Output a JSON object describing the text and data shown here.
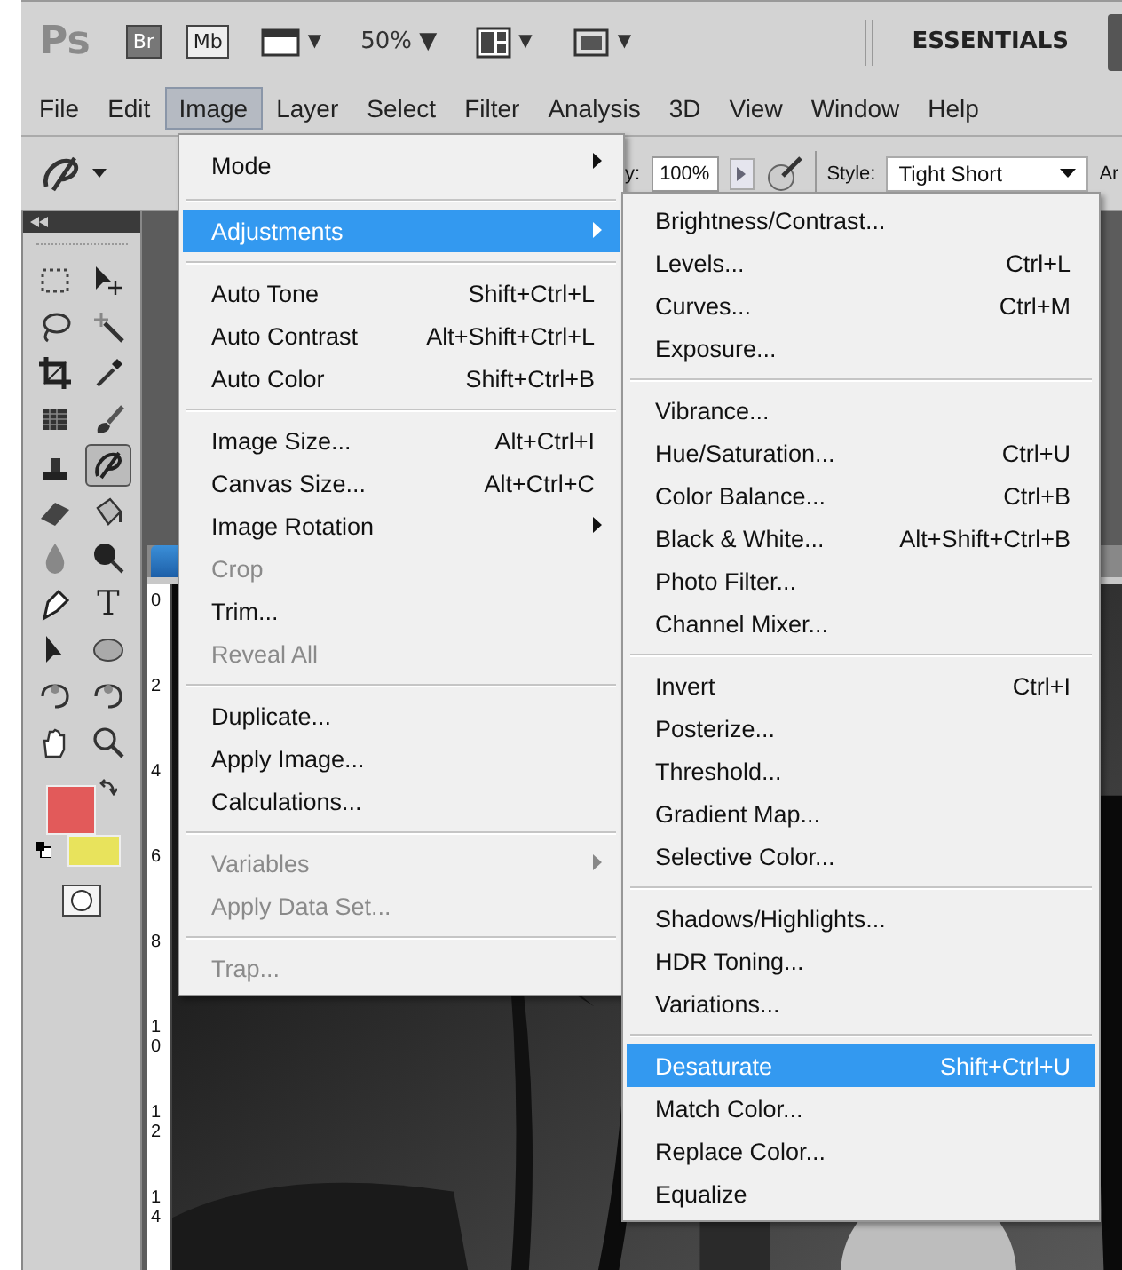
{
  "app_bar": {
    "logo": "Ps",
    "buttons": [
      {
        "kind": "text",
        "label": "Br"
      },
      {
        "kind": "text",
        "label": "Mb"
      },
      {
        "kind": "film",
        "label": "▼"
      },
      {
        "kind": "zoom",
        "label": "50%",
        "caret": "▼"
      },
      {
        "kind": "layout",
        "label": "▼"
      },
      {
        "kind": "screen",
        "label": "▼"
      }
    ],
    "workspace": "ESSENTIALS"
  },
  "menu_bar": [
    {
      "label": "File",
      "selected": false
    },
    {
      "label": "Edit",
      "selected": false
    },
    {
      "label": "Image",
      "selected": true
    },
    {
      "label": "Layer",
      "selected": false
    },
    {
      "label": "Select",
      "selected": false
    },
    {
      "label": "Filter",
      "selected": false
    },
    {
      "label": "Analysis",
      "selected": false
    },
    {
      "label": "3D",
      "selected": false
    },
    {
      "label": "View",
      "selected": false
    },
    {
      "label": "Window",
      "selected": false
    },
    {
      "label": "Help",
      "selected": false
    }
  ],
  "options_bar": {
    "opacity_label": "y:",
    "opacity": "100%",
    "style_label": "Style:",
    "style": "Tight Short",
    "cut_label": "Ar"
  },
  "tools": [
    {
      "kind": "marquee",
      "selected": false
    },
    {
      "kind": "move",
      "selected": false
    },
    {
      "kind": "lasso",
      "selected": false
    },
    {
      "kind": "wand",
      "selected": false
    },
    {
      "kind": "crop",
      "selected": false
    },
    {
      "kind": "eyedropper",
      "selected": false
    },
    {
      "kind": "patch",
      "selected": false
    },
    {
      "kind": "brush",
      "selected": false
    },
    {
      "kind": "stamp",
      "selected": false
    },
    {
      "kind": "history",
      "selected": true
    },
    {
      "kind": "eraser",
      "selected": false
    },
    {
      "kind": "bucket",
      "selected": false
    },
    {
      "kind": "blur",
      "selected": false
    },
    {
      "kind": "dodge",
      "selected": false
    },
    {
      "kind": "pen",
      "selected": false
    },
    {
      "kind": "type",
      "selected": false,
      "glyph": "T"
    },
    {
      "kind": "pointer",
      "selected": false
    },
    {
      "kind": "ellipse",
      "selected": false
    },
    {
      "kind": "rotate3d",
      "selected": false
    },
    {
      "kind": "orbit3d",
      "selected": false
    },
    {
      "kind": "hand",
      "selected": false
    },
    {
      "kind": "zoom",
      "selected": false
    }
  ],
  "ruler": [
    "0",
    "2",
    "4",
    "6",
    "8",
    "10",
    "12",
    "14"
  ],
  "image_menu": [
    [
      {
        "label": "Mode",
        "submenu": true,
        "disabled": false,
        "selected": false
      }
    ],
    [
      {
        "label": "Adjustments",
        "submenu": true,
        "disabled": false,
        "selected": true
      }
    ],
    [
      {
        "label": "Auto Tone",
        "shortcut": "Shift+Ctrl+L",
        "submenu": false,
        "disabled": false,
        "selected": false
      },
      {
        "label": "Auto Contrast",
        "shortcut": "Alt+Shift+Ctrl+L",
        "submenu": false,
        "disabled": false,
        "selected": false
      },
      {
        "label": "Auto Color",
        "shortcut": "Shift+Ctrl+B",
        "submenu": false,
        "disabled": false,
        "selected": false
      }
    ],
    [
      {
        "label": "Image Size...",
        "shortcut": "Alt+Ctrl+I",
        "submenu": false,
        "disabled": false,
        "selected": false
      },
      {
        "label": "Canvas Size...",
        "shortcut": "Alt+Ctrl+C",
        "submenu": false,
        "disabled": false,
        "selected": false
      },
      {
        "label": "Image Rotation",
        "submenu": true,
        "disabled": false,
        "selected": false
      },
      {
        "label": "Crop",
        "submenu": false,
        "disabled": true,
        "selected": false
      },
      {
        "label": "Trim...",
        "submenu": false,
        "disabled": false,
        "selected": false
      },
      {
        "label": "Reveal All",
        "submenu": false,
        "disabled": true,
        "selected": false
      }
    ],
    [
      {
        "label": "Duplicate...",
        "submenu": false,
        "disabled": false,
        "selected": false
      },
      {
        "label": "Apply Image...",
        "submenu": false,
        "disabled": false,
        "selected": false
      },
      {
        "label": "Calculations...",
        "submenu": false,
        "disabled": false,
        "selected": false
      }
    ],
    [
      {
        "label": "Variables",
        "submenu": true,
        "disabled": true,
        "selected": false
      },
      {
        "label": "Apply Data Set...",
        "submenu": false,
        "disabled": true,
        "selected": false
      }
    ],
    [
      {
        "label": "Trap...",
        "submenu": false,
        "disabled": true,
        "selected": false
      }
    ]
  ],
  "adjustments_menu": [
    [
      {
        "label": "Brightness/Contrast...",
        "selected": false
      },
      {
        "label": "Levels...",
        "shortcut": "Ctrl+L",
        "selected": false
      },
      {
        "label": "Curves...",
        "shortcut": "Ctrl+M",
        "selected": false
      },
      {
        "label": "Exposure...",
        "selected": false
      }
    ],
    [
      {
        "label": "Vibrance...",
        "selected": false
      },
      {
        "label": "Hue/Saturation...",
        "shortcut": "Ctrl+U",
        "selected": false
      },
      {
        "label": "Color Balance...",
        "shortcut": "Ctrl+B",
        "selected": false
      },
      {
        "label": "Black & White...",
        "shortcut": "Alt+Shift+Ctrl+B",
        "selected": false
      },
      {
        "label": "Photo Filter...",
        "selected": false
      },
      {
        "label": "Channel Mixer...",
        "selected": false
      }
    ],
    [
      {
        "label": "Invert",
        "shortcut": "Ctrl+I",
        "selected": false
      },
      {
        "label": "Posterize...",
        "selected": false
      },
      {
        "label": "Threshold...",
        "selected": false
      },
      {
        "label": "Gradient Map...",
        "selected": false
      },
      {
        "label": "Selective Color...",
        "selected": false
      }
    ],
    [
      {
        "label": "Shadows/Highlights...",
        "selected": false
      },
      {
        "label": "HDR Toning...",
        "selected": false
      },
      {
        "label": "Variations...",
        "selected": false
      }
    ],
    [
      {
        "label": "Desaturate",
        "shortcut": "Shift+Ctrl+U",
        "selected": true
      },
      {
        "label": "Match Color...",
        "selected": false
      },
      {
        "label": "Replace Color...",
        "selected": false
      },
      {
        "label": "Equalize",
        "selected": false
      }
    ]
  ]
}
